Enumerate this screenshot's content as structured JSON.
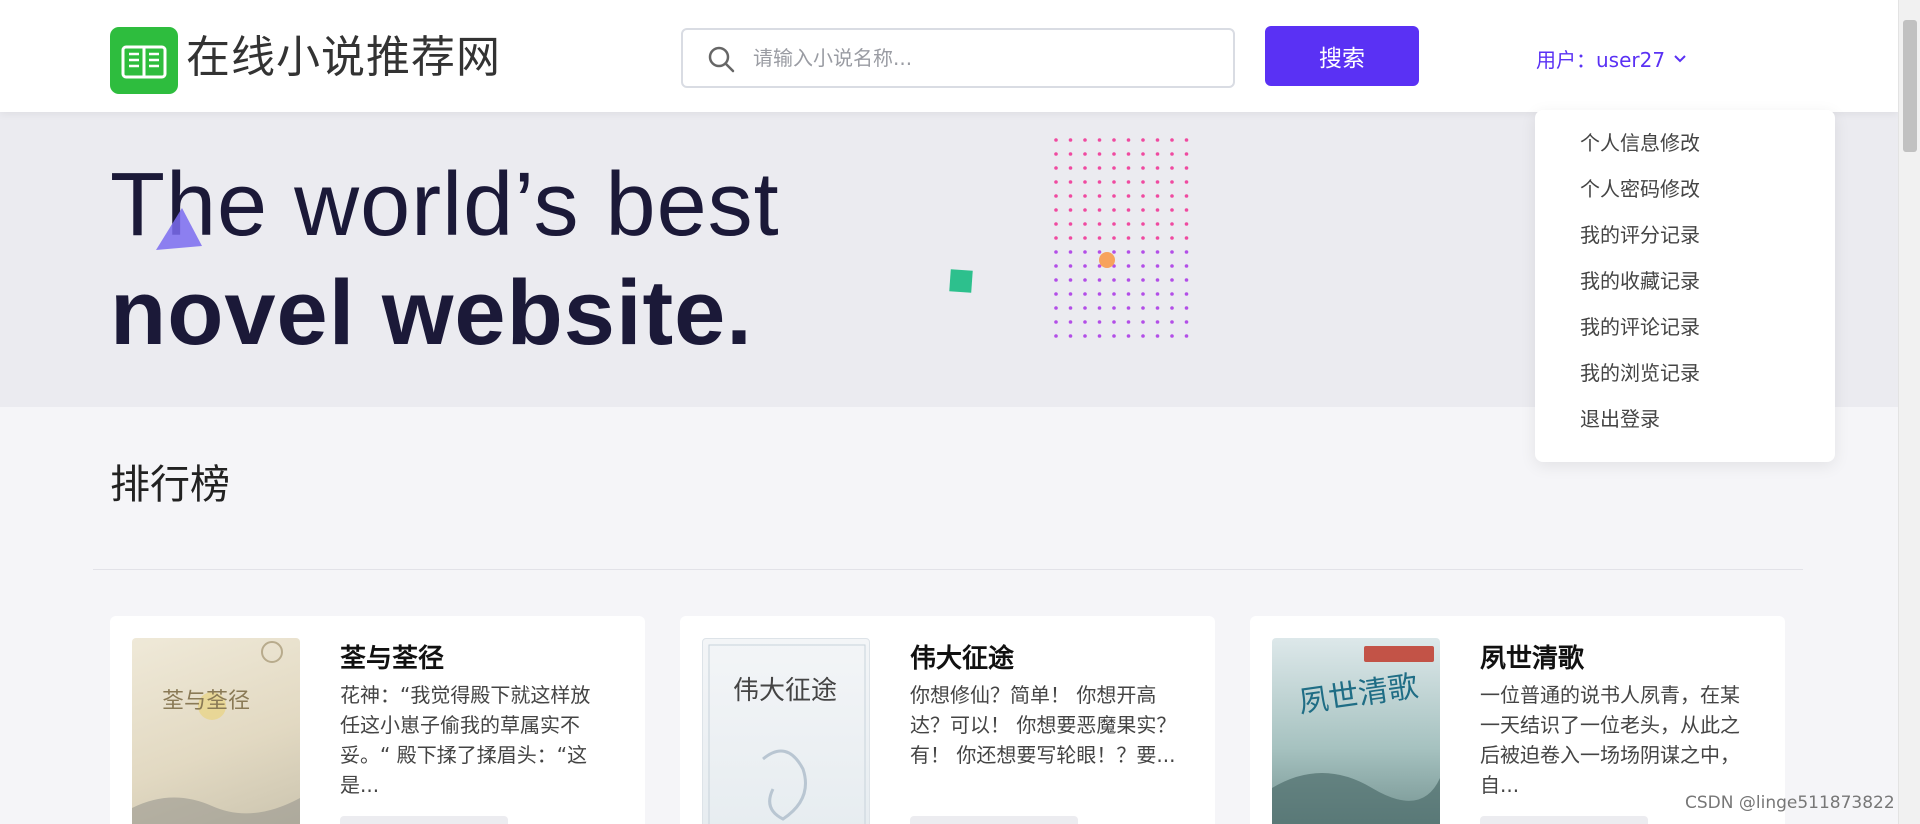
{
  "header": {
    "site_name": "在线小说推荐网",
    "search_placeholder": "请输入小说名称...",
    "search_button": "搜索",
    "user_label": "用户：user27"
  },
  "hero": {
    "line1": "The world’s best",
    "line2": "novel website."
  },
  "user_dropdown": {
    "items": [
      {
        "label": "个人信息修改"
      },
      {
        "label": "个人密码修改"
      },
      {
        "label": "我的评分记录"
      },
      {
        "label": "我的收藏记录"
      },
      {
        "label": "我的评论记录"
      },
      {
        "label": "我的浏览记录"
      },
      {
        "label": "退出登录"
      }
    ]
  },
  "ranking": {
    "title": "排行榜",
    "books": [
      {
        "title": "荃与荃径",
        "desc": "花神：“我觉得殿下就这样放任这小崽子偷我的草属实不妥。“ 殿下揉了揉眉头：“这是...",
        "cover_text": "荃与荃径"
      },
      {
        "title": "伟大征途",
        "desc": "你想修仙？简单！ 你想开高达？可以！ 你想要恶魔果实？有！ 你还想要写轮眼！？要...",
        "cover_text": "伟大征途"
      },
      {
        "title": "夙世清歌",
        "desc": "一位普通的说书人夙青，在某一天结识了一位老头，从此之后被迫卷入一场场阴谋之中，自...",
        "cover_text": "夙世清歌"
      }
    ]
  },
  "watermark": "CSDN @linge511873822",
  "colors": {
    "accent": "#5a31f4",
    "logo_green": "#2ebd3e",
    "hero_bg": "#ebebf0"
  }
}
